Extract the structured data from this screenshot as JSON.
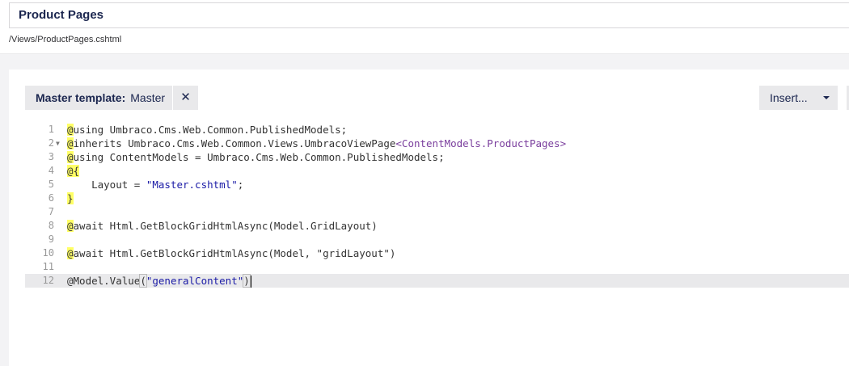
{
  "header": {
    "name": "Product Pages",
    "path": "/Views/ProductPages.cshtml"
  },
  "toolbar": {
    "master_label": "Master template:",
    "master_value": "Master",
    "remove_symbol": "✕",
    "insert_label": "Insert..."
  },
  "code": {
    "lines": [
      {
        "num": "1"
      },
      {
        "num": "2"
      },
      {
        "num": "3"
      },
      {
        "num": "4"
      },
      {
        "num": "5"
      },
      {
        "num": "6"
      },
      {
        "num": "7"
      },
      {
        "num": "8"
      },
      {
        "num": "9"
      },
      {
        "num": "10"
      },
      {
        "num": "11"
      },
      {
        "num": "12"
      }
    ],
    "l1": {
      "at": "@",
      "rest": "using Umbraco.Cms.Web.Common.PublishedModels;"
    },
    "l2": {
      "at": "@",
      "a": "inherits Umbraco.Cms.Web.Common.Views.UmbracoViewPage",
      "type": "<ContentModels.ProductPages>"
    },
    "l3": {
      "at": "@",
      "rest": "using ContentModels = Umbraco.Cms.Web.Common.PublishedModels;"
    },
    "l4": {
      "at": "@{"
    },
    "l5": {
      "a": "    Layout = ",
      "str": "\"Master.cshtml\"",
      "b": ";"
    },
    "l6": {
      "at": "}"
    },
    "l8": {
      "at": "@",
      "rest": "await Html.GetBlockGridHtmlAsync(Model.GridLayout)"
    },
    "l10": {
      "at": "@",
      "rest": "await Html.GetBlockGridHtmlAsync(Model, \"gridLayout\")"
    },
    "l12": {
      "a": "@Model.Value",
      "open": "(",
      "str": "\"generalContent\"",
      "close": ")"
    }
  }
}
